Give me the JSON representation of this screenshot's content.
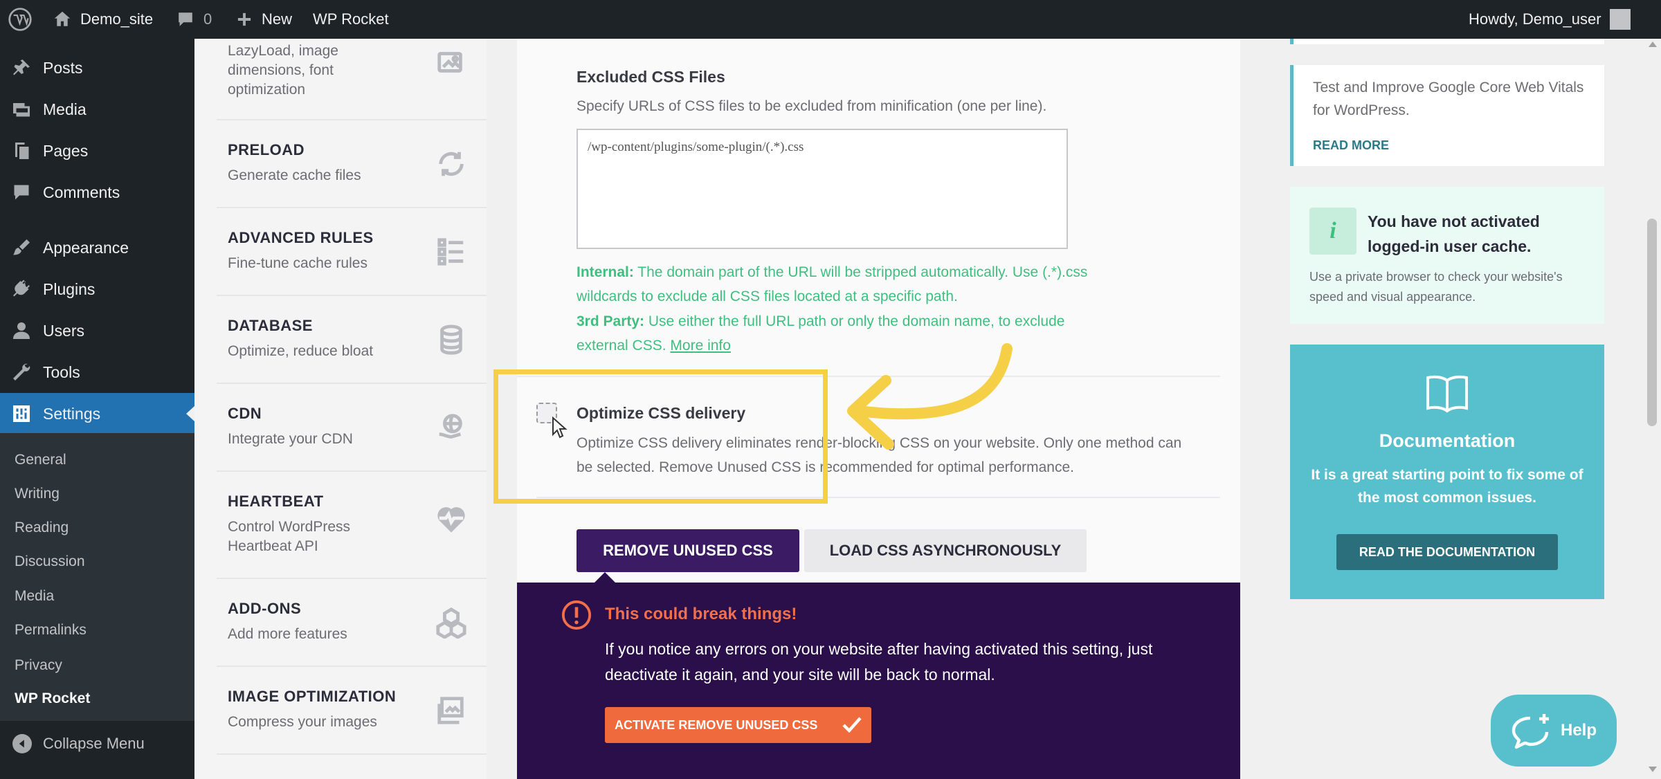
{
  "adminbar": {
    "site_name": "Demo_site",
    "comments_count": "0",
    "new_label": "New",
    "plugin_label": "WP Rocket",
    "greeting": "Howdy, Demo_user"
  },
  "sidebar": {
    "items": [
      {
        "label": "Posts",
        "icon": "pin-icon"
      },
      {
        "label": "Media",
        "icon": "media-icon"
      },
      {
        "label": "Pages",
        "icon": "pages-icon"
      },
      {
        "label": "Comments",
        "icon": "comment-icon"
      },
      {
        "label": "Appearance",
        "icon": "brush-icon"
      },
      {
        "label": "Plugins",
        "icon": "plug-icon"
      },
      {
        "label": "Users",
        "icon": "user-icon"
      },
      {
        "label": "Tools",
        "icon": "wrench-icon"
      },
      {
        "label": "Settings",
        "icon": "settings-icon"
      }
    ],
    "submenu": [
      "General",
      "Writing",
      "Reading",
      "Discussion",
      "Media",
      "Permalinks",
      "Privacy",
      "WP Rocket"
    ],
    "collapse_label": "Collapse Menu"
  },
  "rocket_nav": {
    "partial_desc": "LazyLoad, image dimensions, font optimization",
    "entries": [
      {
        "title": "PRELOAD",
        "desc": "Generate cache files"
      },
      {
        "title": "ADVANCED RULES",
        "desc": "Fine-tune cache rules"
      },
      {
        "title": "DATABASE",
        "desc": "Optimize, reduce bloat"
      },
      {
        "title": "CDN",
        "desc": "Integrate your CDN"
      },
      {
        "title": "HEARTBEAT",
        "desc": "Control WordPress Heartbeat API"
      },
      {
        "title": "ADD-ONS",
        "desc": "Add more features"
      },
      {
        "title": "IMAGE OPTIMIZATION",
        "desc": "Compress your images"
      }
    ]
  },
  "main": {
    "excluded_title": "Excluded CSS Files",
    "excluded_desc": "Specify URLs of CSS files to be excluded from minification (one per line).",
    "textarea_value": "/wp-content/plugins/some-plugin/(.*).css",
    "internal_label": "Internal:",
    "internal_text": " The domain part of the URL will be stripped automatically. Use (.*).css wildcards to exclude all CSS files located at a specific path.",
    "third_label": "3rd Party:",
    "third_text": " Use either the full URL path or only the domain name, to exclude external CSS. ",
    "more_info": "More info",
    "optimize_title": "Optimize CSS delivery",
    "optimize_desc": "Optimize CSS delivery eliminates render-blocking CSS on your website. Only one method can be selected. Remove Unused CSS is recommended for optimal performance.",
    "btn_remove": "REMOVE UNUSED CSS",
    "btn_load": "LOAD CSS ASYNCHRONOUSLY",
    "warning_title": "This could break things!",
    "warning_text": "If you notice any errors on your website after having activated this setting, just deactivate it again, and your site will be back to normal.",
    "warning_btn": "ACTIVATE REMOVE UNUSED CSS"
  },
  "right": {
    "card1_text": "Test and Improve Google Core Web Vitals for WordPress.",
    "card1_link": "READ MORE",
    "card2_title": "You have not activated logged-in user cache.",
    "card2_text": "Use a private browser to check your website's speed and visual appearance.",
    "doc_title": "Documentation",
    "doc_text": "It is a great starting point to fix some of the most common issues.",
    "doc_btn": "READ THE DOCUMENTATION"
  },
  "help_label": "Help",
  "colors": {
    "primary": "#3b1b63",
    "accent_orange": "#ef6a3d",
    "highlight_yellow": "#f5cf45",
    "teal": "#58bfcd",
    "wp_blue": "#2271b1"
  }
}
